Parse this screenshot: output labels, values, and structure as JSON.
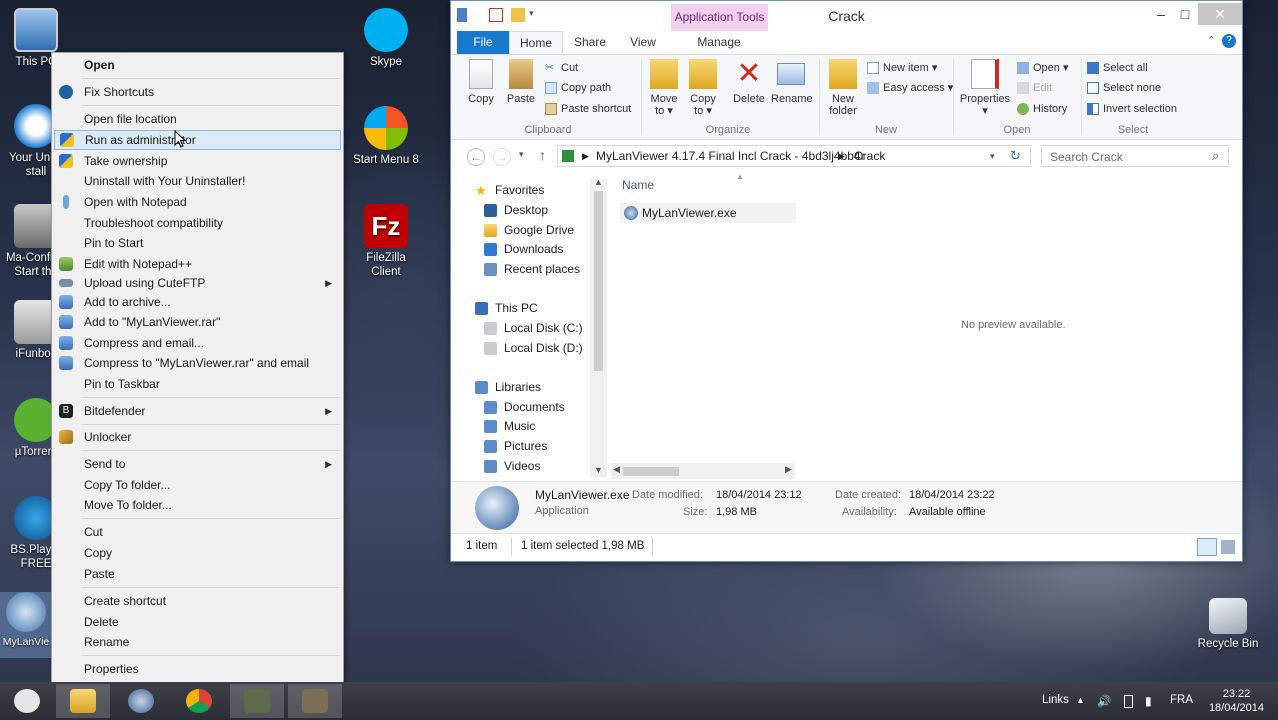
{
  "desktop_icons": [
    {
      "label": "This PC",
      "icon": "computer-icon"
    },
    {
      "label": "Your Unin-stall",
      "icon": "uninstaller-icon"
    },
    {
      "label": "Ma-Config - Start the",
      "icon": "config-icon"
    },
    {
      "label": "iFunbox",
      "icon": "ifunbox-icon"
    },
    {
      "label": "µTorrent",
      "icon": "utorrent-icon"
    },
    {
      "label": "BS.Player FREE",
      "icon": "bsplayer-icon"
    },
    {
      "label": "MyLanVie",
      "icon": "mylanviewer-icon"
    },
    {
      "label": "Skype",
      "icon": "skype-icon"
    },
    {
      "label": "Start Menu 8",
      "icon": "startmenu-icon"
    },
    {
      "label": "FileZilla Client",
      "icon": "filezilla-icon"
    },
    {
      "label": "Recycle Bin",
      "icon": "recycle-bin-icon"
    }
  ],
  "context_menu": {
    "items": [
      {
        "label": "Open",
        "bold": true
      },
      {
        "label": "Fix Shortcuts"
      },
      {
        "label": "Open file location"
      },
      {
        "label": "Run as administrator",
        "highlighted": true
      },
      {
        "label": "Take ownership"
      },
      {
        "label": "Uninstall with Your Uninstaller!"
      },
      {
        "label": "Open with Notepad"
      },
      {
        "label": "Troubleshoot compatibility"
      },
      {
        "label": "Pin to Start"
      },
      {
        "label": "Edit with Notepad++"
      },
      {
        "label": "Upload using CuteFTP",
        "submenu": true
      },
      {
        "label": "Add to archive..."
      },
      {
        "label": "Add to \"MyLanViewer.rar\""
      },
      {
        "label": "Compress and email..."
      },
      {
        "label": "Compress to \"MyLanViewer.rar\" and email"
      },
      {
        "label": "Pin to Taskbar"
      },
      {
        "label": "Bitdefender",
        "submenu": true
      },
      {
        "label": "Unlocker"
      },
      {
        "label": "Send to",
        "submenu": true
      },
      {
        "label": "Copy To folder..."
      },
      {
        "label": "Move To folder..."
      },
      {
        "label": "Cut"
      },
      {
        "label": "Copy"
      },
      {
        "label": "Paste"
      },
      {
        "label": "Create shortcut"
      },
      {
        "label": "Delete"
      },
      {
        "label": "Rename"
      },
      {
        "label": "Properties"
      }
    ]
  },
  "explorer": {
    "title": "Crack",
    "app_tools": "Application Tools",
    "tabs": {
      "file": "File",
      "home": "Home",
      "share": "Share",
      "view": "View",
      "manage": "Manage"
    },
    "ribbon": {
      "clipboard": {
        "label": "Clipboard",
        "copy": "Copy",
        "paste": "Paste",
        "cut": "Cut",
        "copy_path": "Copy path",
        "paste_shortcut": "Paste shortcut"
      },
      "organize": {
        "label": "Organize",
        "move_to": "Move to",
        "copy_to": "Copy to",
        "delete": "Delete",
        "rename": "Rename"
      },
      "new": {
        "label": "New",
        "new_folder": "New folder",
        "new_item": "New item",
        "easy_access": "Easy access"
      },
      "open": {
        "label": "Open",
        "properties": "Properties",
        "open": "Open",
        "edit": "Edit",
        "history": "History"
      },
      "select": {
        "label": "Select",
        "select_all": "Select all",
        "select_none": "Select none",
        "invert": "Invert selection"
      }
    },
    "address": {
      "segment1": "MyLanViewer 4.17.4 Final Incl Crack - 4bd3lj4bb4r",
      "segment2": "Crack",
      "search_placeholder": "Search Crack"
    },
    "nav": {
      "favorites": "Favorites",
      "fav_items": [
        "Desktop",
        "Google Drive",
        "Downloads",
        "Recent places"
      ],
      "this_pc": "This PC",
      "pc_items": [
        "Local Disk (C:)",
        "Local Disk (D:)"
      ],
      "libraries": "Libraries",
      "lib_items": [
        "Documents",
        "Music",
        "Pictures",
        "Videos"
      ]
    },
    "content": {
      "column_name": "Name",
      "file": "MyLanViewer.exe",
      "preview": "No preview available."
    },
    "details": {
      "name": "MyLanViewer.exe",
      "type": "Application",
      "date_modified_label": "Date modified:",
      "date_modified": "18/04/2014 23:12",
      "size_label": "Size:",
      "size": "1,98 MB",
      "date_created_label": "Date created:",
      "date_created": "18/04/2014 23:22",
      "availability_label": "Availability:",
      "availability": "Available offline"
    },
    "status": {
      "count": "1 item",
      "selected": "1 item selected  1,98 MB"
    }
  },
  "taskbar": {
    "links": "Links",
    "lang": "FRA",
    "time": "23:22",
    "date": "18/04/2014"
  }
}
